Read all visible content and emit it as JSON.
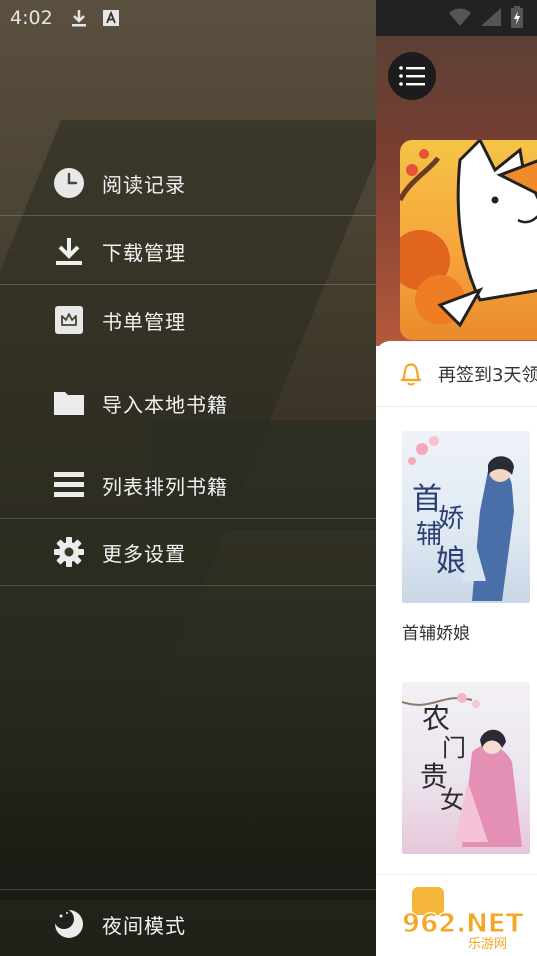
{
  "status_bar": {
    "time": "4:02",
    "icons": [
      "download-notification-icon",
      "a-notification-icon",
      "wifi-icon",
      "signal-icon",
      "battery-icon"
    ]
  },
  "drawer": {
    "menu": [
      {
        "label": "阅读记录",
        "icon": "clock-icon"
      },
      {
        "label": "下载管理",
        "icon": "download-icon"
      },
      {
        "label": "书单管理",
        "icon": "crown-icon"
      },
      {
        "label": "导入本地书籍",
        "icon": "folder-icon"
      },
      {
        "label": "列表排列书籍",
        "icon": "list-icon"
      },
      {
        "label": "更多设置",
        "icon": "gear-icon"
      }
    ],
    "night_mode": {
      "label": "夜间模式",
      "icon": "moon-icon"
    }
  },
  "content": {
    "signin_text": "再签到3天领",
    "books": [
      {
        "title": "首辅娇娘",
        "cover_text": "首辅娇娘"
      },
      {
        "title": "",
        "cover_text": "农门贵女"
      }
    ]
  },
  "watermark": {
    "text": "962.NET",
    "sub": "乐游网"
  },
  "colors": {
    "drawer_text": "#f2f2f2",
    "bell": "#f5a623",
    "content_bg": "#ffffff"
  }
}
